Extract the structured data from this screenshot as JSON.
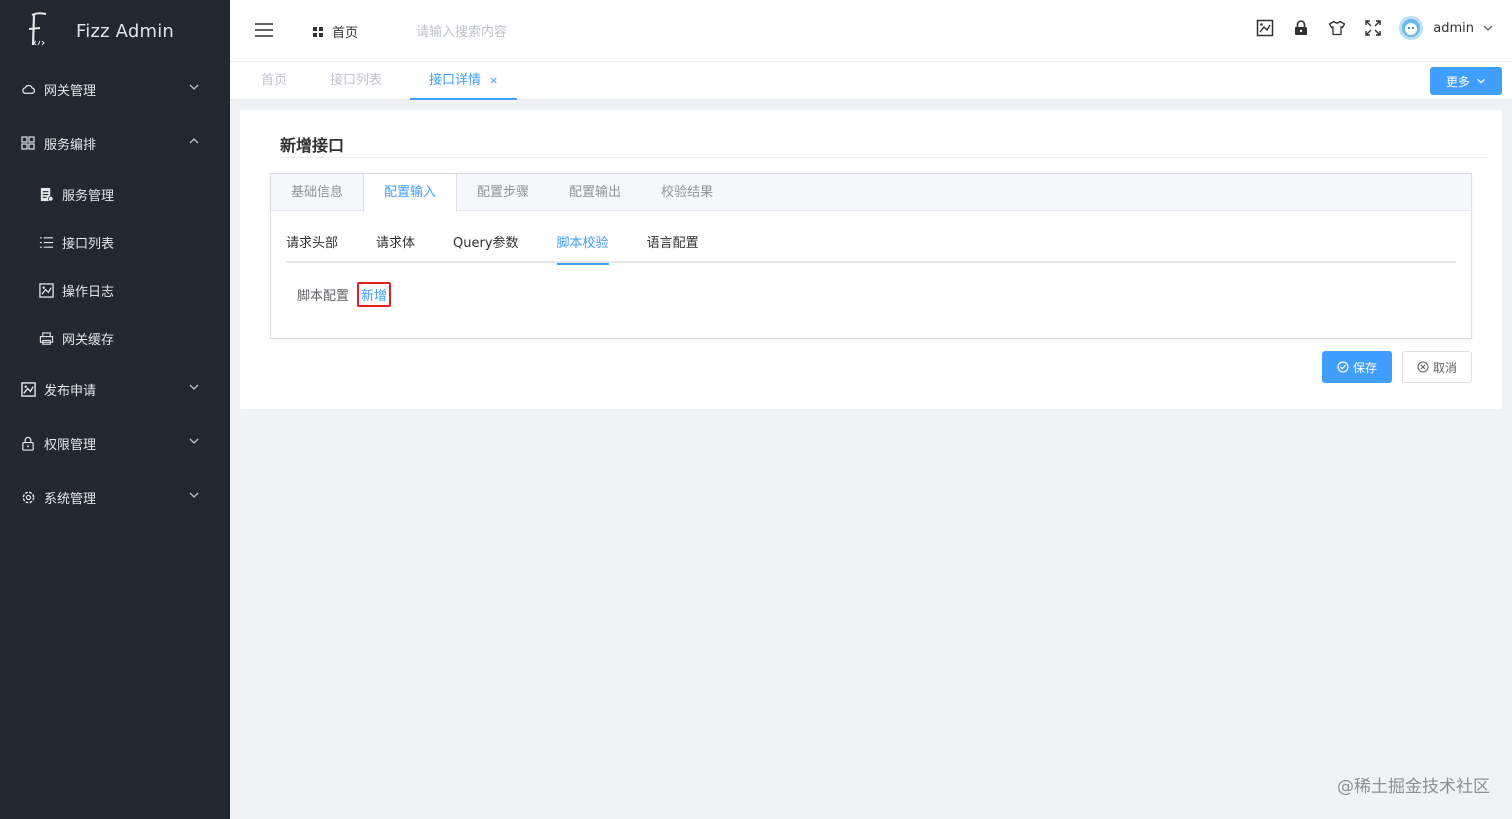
{
  "app": {
    "title": "Fizz Admin"
  },
  "sidebar": {
    "menus": [
      {
        "label": "网关管理",
        "icon": "cloud-icon",
        "expanded": false
      },
      {
        "label": "服务编排",
        "icon": "grid-icon",
        "expanded": true,
        "children": [
          {
            "label": "服务管理",
            "icon": "document-list-icon"
          },
          {
            "label": "接口列表",
            "icon": "list-icon"
          },
          {
            "label": "操作日志",
            "icon": "image-log-icon"
          },
          {
            "label": "网关缓存",
            "icon": "printer-icon"
          }
        ]
      },
      {
        "label": "发布申请",
        "icon": "publish-icon",
        "expanded": false
      },
      {
        "label": "权限管理",
        "icon": "lock-icon",
        "expanded": false
      },
      {
        "label": "系统管理",
        "icon": "gear-icon",
        "expanded": false
      }
    ]
  },
  "header": {
    "home_label": "首页",
    "search_placeholder": "请输入搜索内容",
    "username": "admin"
  },
  "tags": {
    "items": [
      {
        "label": "首页",
        "active": false
      },
      {
        "label": "接口列表",
        "active": false
      },
      {
        "label": "接口详情",
        "active": true,
        "close": "×"
      }
    ],
    "more_label": "更多"
  },
  "main": {
    "title": "新增接口",
    "tabs": [
      "基础信息",
      "配置输入",
      "配置步骤",
      "配置输出",
      "校验结果"
    ],
    "active_tab": 1,
    "subtabs": [
      "请求头部",
      "请求体",
      "Query参数",
      "脚本校验",
      "语言配置"
    ],
    "active_subtab": 3,
    "script_label": "脚本配置",
    "add_label": "新增",
    "save_label": "保存",
    "cancel_label": "取消"
  },
  "watermark": "@稀土掘金技术社区",
  "colors": {
    "sidebar_bg": "#222832",
    "accent": "#409eff",
    "highlight": "#e02020"
  }
}
